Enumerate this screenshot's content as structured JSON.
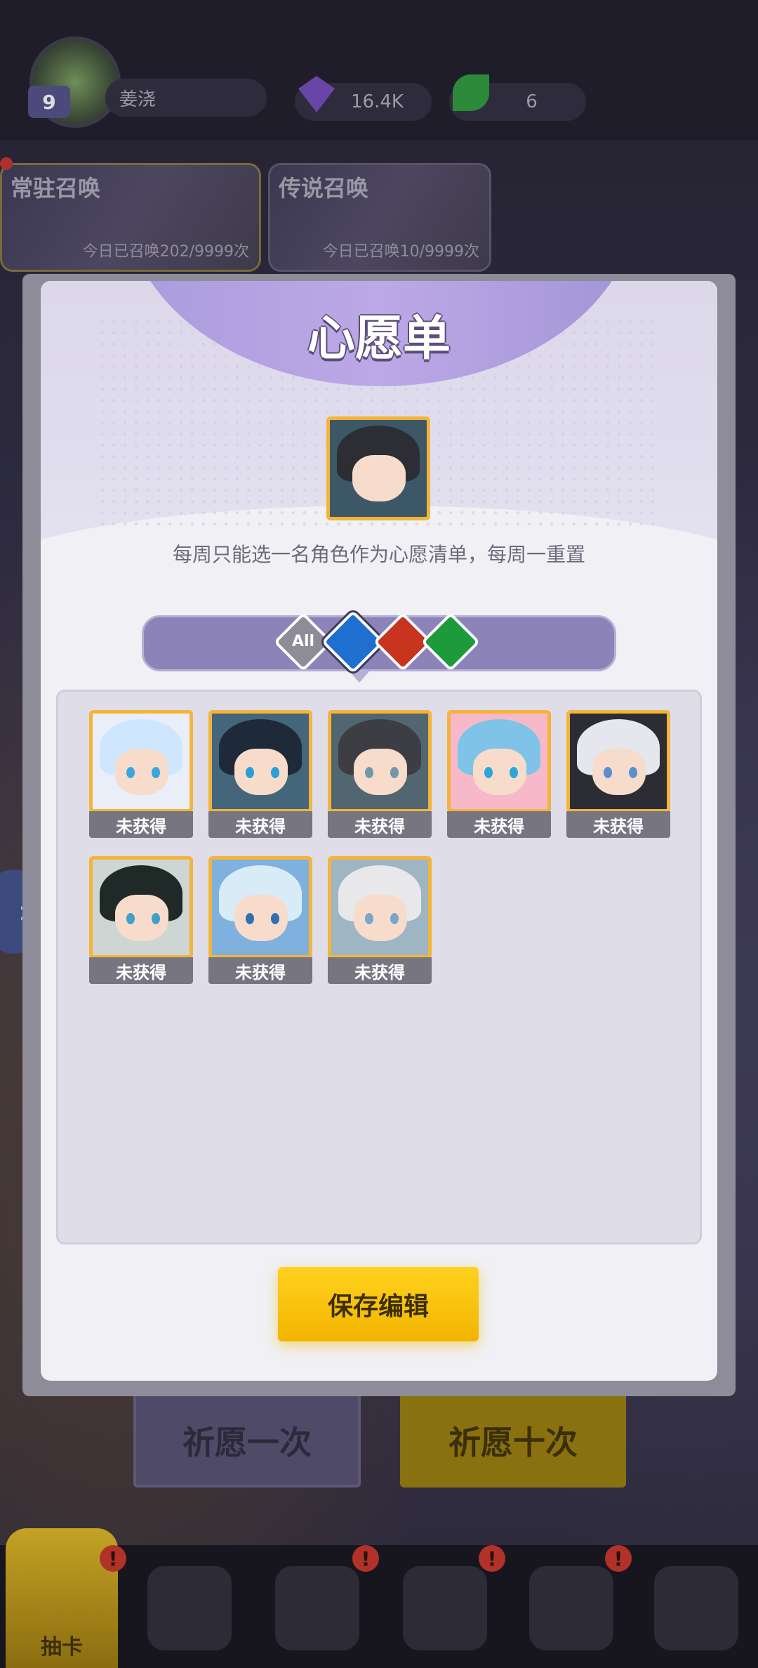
{
  "player": {
    "level": "9",
    "name": "姜浇"
  },
  "currencies": {
    "gems": "16.4K",
    "leaves": "6"
  },
  "banners": [
    {
      "title": "常驻召唤",
      "count": "今日已召唤202/9999次"
    },
    {
      "title": "传说召唤",
      "count": "今日已召唤10/9999次"
    }
  ],
  "background_buttons": {
    "once": "祈愿一次",
    "ten": "祈愿十次"
  },
  "bottom_nav": {
    "active_label": "抽卡",
    "badge": "!"
  },
  "dialog": {
    "title": "心愿单",
    "description": "每周只能选一名角色作为心愿清单，每周一重置",
    "filters": {
      "all": "All",
      "selected": "water"
    },
    "save_label": "保存编辑"
  },
  "characters": [
    {
      "status": "未获得",
      "hair": "#cfe6ff",
      "bg": "#e9eef8",
      "eye": "#3aa6e0"
    },
    {
      "status": "未获得",
      "hair": "#1e2a3a",
      "bg": "#43667a",
      "eye": "#2a9ed6"
    },
    {
      "status": "未获得",
      "hair": "#3c3e44",
      "bg": "#516670",
      "eye": "#6f98a8"
    },
    {
      "status": "未获得",
      "hair": "#7fc4e8",
      "bg": "#f7b9c9",
      "eye": "#2aa7d8"
    },
    {
      "status": "未获得",
      "hair": "#e6e6ee",
      "bg": "#2c2c34",
      "eye": "#5a8fd0"
    },
    {
      "status": "未获得",
      "hair": "#1f2a28",
      "bg": "#cdd6d2",
      "eye": "#3fa0c8"
    },
    {
      "status": "未获得",
      "hair": "#d8ecf8",
      "bg": "#7fb0de",
      "eye": "#2f6fb0"
    },
    {
      "status": "未获得",
      "hair": "#e8e8ea",
      "bg": "#9eb5c4",
      "eye": "#7aa6c8"
    }
  ]
}
